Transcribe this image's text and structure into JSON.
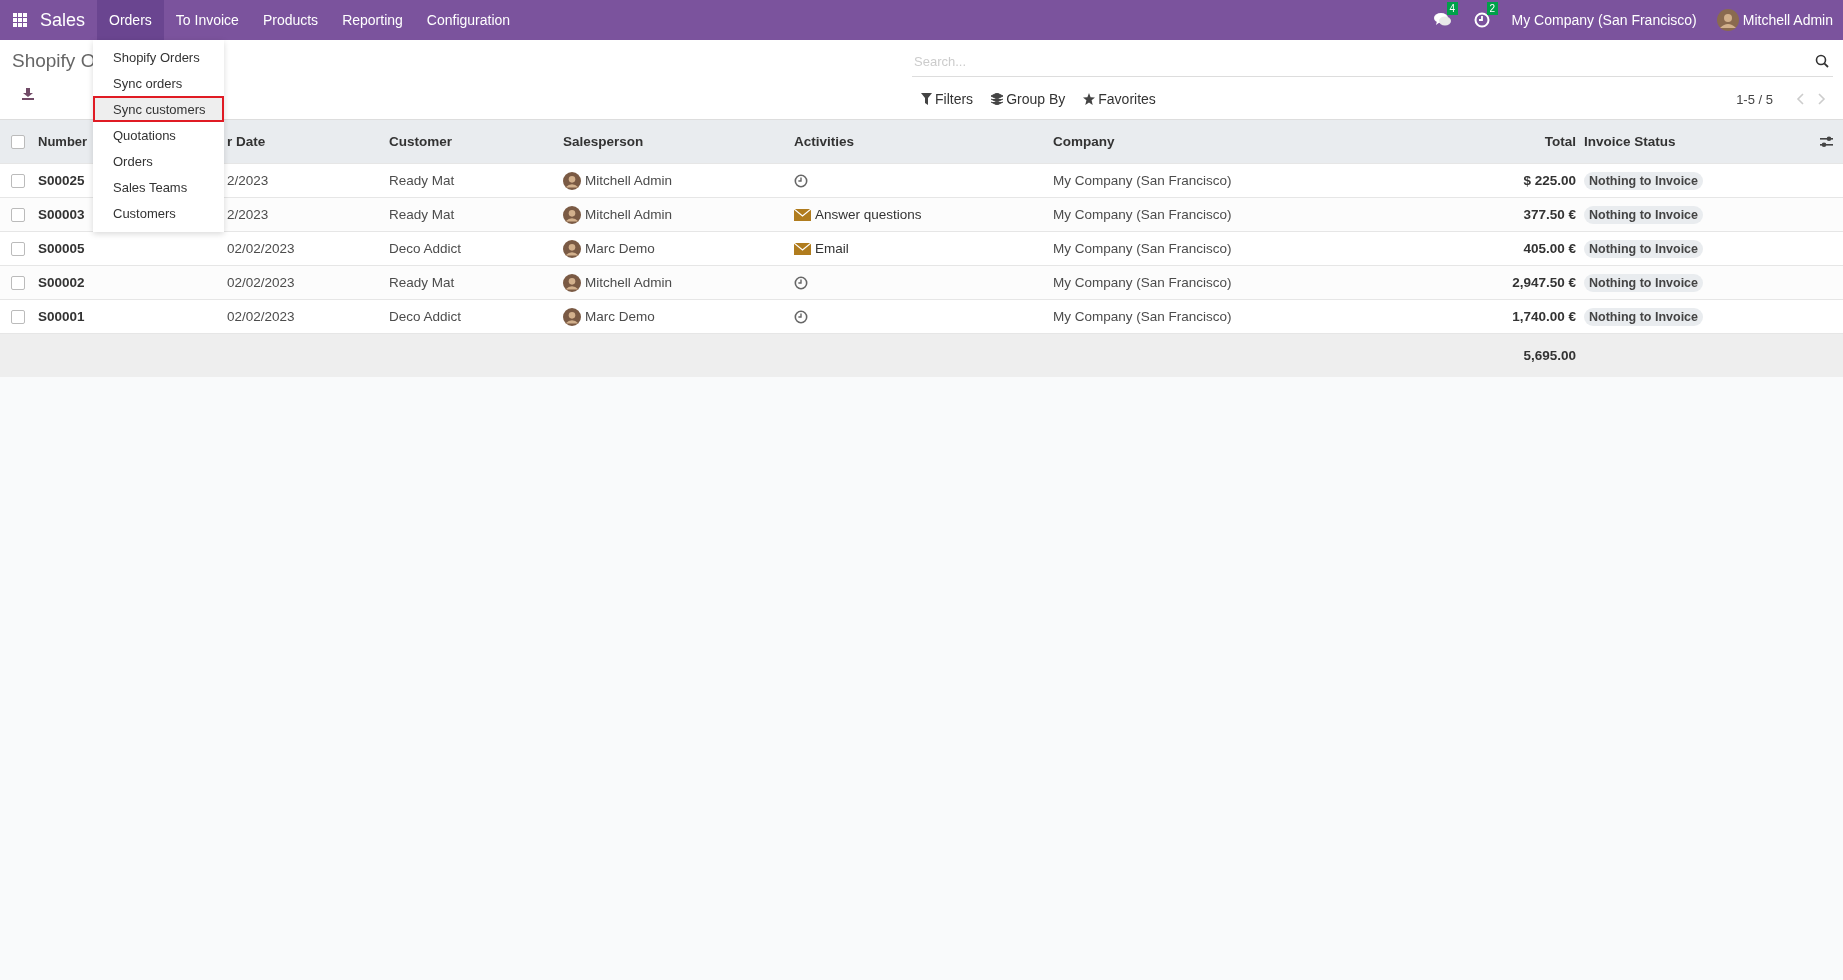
{
  "navbar": {
    "app_name": "Sales",
    "menu": [
      {
        "label": "Orders",
        "selected": true
      },
      {
        "label": "To Invoice",
        "selected": false
      },
      {
        "label": "Products",
        "selected": false
      },
      {
        "label": "Reporting",
        "selected": false
      },
      {
        "label": "Configuration",
        "selected": false
      }
    ],
    "messages_count": "4",
    "activities_count": "2",
    "company": "My Company (San Francisco)",
    "user": "Mitchell Admin"
  },
  "dropdown": [
    {
      "label": "Shopify Orders",
      "selected": false
    },
    {
      "label": "Sync orders",
      "selected": false
    },
    {
      "label": "Sync customers",
      "selected": true
    },
    {
      "label": "Quotations",
      "selected": false
    },
    {
      "label": "Orders",
      "selected": false
    },
    {
      "label": "Sales Teams",
      "selected": false
    },
    {
      "label": "Customers",
      "selected": false
    }
  ],
  "page_title": "Shopify O",
  "search": {
    "placeholder": "Search..."
  },
  "search_options": [
    "Filters",
    "Group By",
    "Favorites"
  ],
  "pager": "1-5 / 5",
  "table": {
    "all_checked": false,
    "columns": [
      "Number",
      "r Date",
      "Customer",
      "Salesperson",
      "Activities",
      "Company",
      "Total",
      "Invoice Status"
    ],
    "rows": [
      {
        "checked": false,
        "number": "S00025",
        "date": "2/2023",
        "customer": "Ready Mat",
        "salesperson": "Mitchell Admin",
        "activity": {
          "kind": "clock"
        },
        "company": "My Company (San Francisco)",
        "total": "$ 225.00",
        "status": "Nothing to Invoice"
      },
      {
        "checked": false,
        "number": "S00003",
        "date": "2/2023",
        "customer": "Ready Mat",
        "salesperson": "Mitchell Admin",
        "activity": {
          "kind": "mail",
          "label": "Answer questions"
        },
        "company": "My Company (San Francisco)",
        "total": "377.50 €",
        "status": "Nothing to Invoice"
      },
      {
        "checked": false,
        "number": "S00005",
        "date": "02/02/2023",
        "customer": "Deco Addict",
        "salesperson": "Marc Demo",
        "activity": {
          "kind": "mail",
          "label": "Email"
        },
        "company": "My Company (San Francisco)",
        "total": "405.00 €",
        "status": "Nothing to Invoice"
      },
      {
        "checked": false,
        "number": "S00002",
        "date": "02/02/2023",
        "customer": "Ready Mat",
        "salesperson": "Mitchell Admin",
        "activity": {
          "kind": "clock"
        },
        "company": "My Company (San Francisco)",
        "total": "2,947.50 €",
        "status": "Nothing to Invoice"
      },
      {
        "checked": false,
        "number": "S00001",
        "date": "02/02/2023",
        "customer": "Deco Addict",
        "salesperson": "Marc Demo",
        "activity": {
          "kind": "clock"
        },
        "company": "My Company (San Francisco)",
        "total": "1,740.00 €",
        "status": "Nothing to Invoice"
      }
    ],
    "sum_total": "5,695.00"
  }
}
